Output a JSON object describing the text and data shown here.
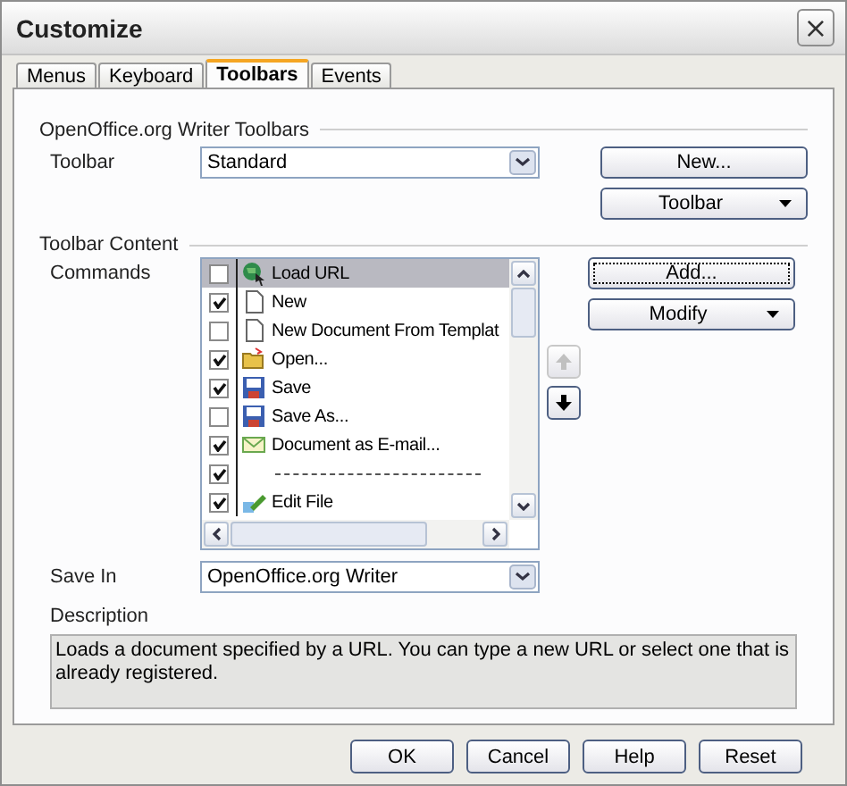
{
  "window": {
    "title": "Customize",
    "close": "×"
  },
  "tabs": [
    {
      "label": "Menus",
      "selected": false
    },
    {
      "label": "Keyboard",
      "selected": false
    },
    {
      "label": "Toolbars",
      "selected": true
    },
    {
      "label": "Events",
      "selected": false
    }
  ],
  "toolbars_section": {
    "heading": "OpenOffice.org Writer Toolbars",
    "toolbar_label": "Toolbar",
    "toolbar_value": "Standard",
    "new_button": "New...",
    "toolbar_menu": "Toolbar"
  },
  "content_section": {
    "heading": "Toolbar Content",
    "commands_label": "Commands",
    "add_button": "Add...",
    "modify_menu": "Modify",
    "move_up_disabled": true,
    "move_down_disabled": false
  },
  "commands": [
    {
      "kind": "command",
      "label": "Load URL",
      "checked": false,
      "selected": true
    },
    {
      "kind": "command",
      "label": "New",
      "checked": true,
      "selected": false
    },
    {
      "kind": "command",
      "label": "New Document From Templat",
      "checked": false,
      "selected": false
    },
    {
      "kind": "command",
      "label": "Open...",
      "checked": true,
      "selected": false
    },
    {
      "kind": "command",
      "label": "Save",
      "checked": true,
      "selected": false
    },
    {
      "kind": "command",
      "label": "Save As...",
      "checked": false,
      "selected": false
    },
    {
      "kind": "command",
      "label": "Document as E-mail...",
      "checked": true,
      "selected": false
    },
    {
      "kind": "separator",
      "checked": true,
      "selected": false
    },
    {
      "kind": "command",
      "label": "Edit File",
      "checked": true,
      "selected": false
    }
  ],
  "save_in": {
    "label": "Save In",
    "value": "OpenOffice.org Writer"
  },
  "description": {
    "label": "Description",
    "text": "Loads a document specified by a URL. You can type a new URL or select one that is already registered."
  },
  "buttons": [
    {
      "label": "OK"
    },
    {
      "label": "Cancel"
    },
    {
      "label": "Help"
    },
    {
      "label": "Reset"
    }
  ]
}
